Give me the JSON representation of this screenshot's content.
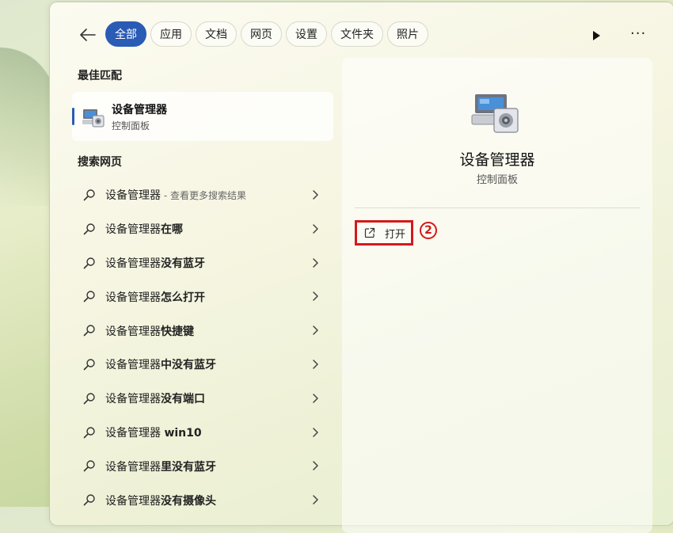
{
  "tabs": [
    {
      "label": "全部",
      "active": true
    },
    {
      "label": "应用",
      "active": false
    },
    {
      "label": "文档",
      "active": false
    },
    {
      "label": "网页",
      "active": false
    },
    {
      "label": "设置",
      "active": false
    },
    {
      "label": "文件夹",
      "active": false
    },
    {
      "label": "照片",
      "active": false
    }
  ],
  "icons": {
    "back": "back-arrow-icon",
    "play": "play-icon",
    "more": "more-options-icon",
    "search": "search-icon",
    "chevron": "chevron-right-icon",
    "open": "open-external-icon",
    "app": "device-manager-icon"
  },
  "best_match": {
    "heading": "最佳匹配",
    "name": "设备管理器",
    "category": "控制面板"
  },
  "web_search": {
    "heading": "搜索网页",
    "results": [
      {
        "prefix": "设备管理器",
        "bold": "",
        "hint": " - 查看更多搜索结果"
      },
      {
        "prefix": "设备管理器",
        "bold": "在哪",
        "hint": ""
      },
      {
        "prefix": "设备管理器",
        "bold": "没有蓝牙",
        "hint": ""
      },
      {
        "prefix": "设备管理器",
        "bold": "怎么打开",
        "hint": ""
      },
      {
        "prefix": "设备管理器",
        "bold": "快捷键",
        "hint": ""
      },
      {
        "prefix": "设备管理器",
        "bold": "中没有蓝牙",
        "hint": ""
      },
      {
        "prefix": "设备管理器",
        "bold": "没有端口",
        "hint": ""
      },
      {
        "prefix": "设备管理器 ",
        "bold": "win10",
        "hint": ""
      },
      {
        "prefix": "设备管理器",
        "bold": "里没有蓝牙",
        "hint": ""
      },
      {
        "prefix": "设备管理器",
        "bold": "没有摄像头",
        "hint": ""
      }
    ]
  },
  "detail": {
    "title": "设备管理器",
    "category": "控制面板",
    "open_label": "打开",
    "step_marker": "2"
  },
  "colors": {
    "accent": "#2a5bb5",
    "highlight_box": "#d21a1a"
  }
}
